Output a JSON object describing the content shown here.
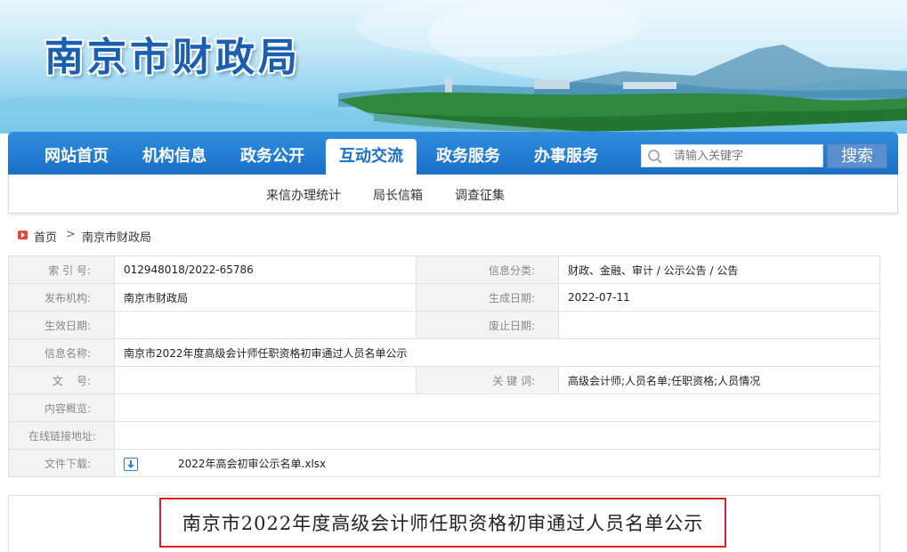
{
  "header": {
    "site_title": "南京市财政局"
  },
  "nav": {
    "items": [
      {
        "label": "网站首页",
        "active": false
      },
      {
        "label": "机构信息",
        "active": false
      },
      {
        "label": "政务公开",
        "active": false
      },
      {
        "label": "互动交流",
        "active": true
      },
      {
        "label": "政务服务",
        "active": false
      },
      {
        "label": "办事服务",
        "active": false
      }
    ],
    "search_placeholder": "请输入关键字",
    "search_button": "搜索"
  },
  "subnav": {
    "items": [
      "来信办理统计",
      "局长信箱",
      "调查征集"
    ]
  },
  "breadcrumb": {
    "home": "首页",
    "separator": ">",
    "current": "南京市财政局"
  },
  "info": {
    "index_label": "索 引 号:",
    "index_value": "012948018/2022-65786",
    "category_label": "信息分类:",
    "category_value": "财政、金融、审计 / 公示公告 / 公告",
    "publisher_label": "发布机构:",
    "publisher_value": "南京市财政局",
    "created_label": "生成日期:",
    "created_value": "2022-07-11",
    "effective_label": "生效日期:",
    "effective_value": "",
    "abolish_label": "废止日期:",
    "abolish_value": "",
    "name_label": "信息名称:",
    "name_value": "南京市2022年度高级会计师任职资格初审通过人员名单公示",
    "doc_label": "文    号:",
    "doc_value": "",
    "keywords_label": "关 键 词:",
    "keywords_value": "高级会计师;人员名单;任职资格;人员情况",
    "overview_label": "内容概览:",
    "overview_value": "",
    "link_label": "在线链接地址:",
    "link_value": "",
    "download_label": "文件下载:",
    "download_value": "2022年高会初审公示名单.xlsx"
  },
  "article": {
    "title": "南京市2022年度高级会计师任职资格初审通过人员名单公示"
  }
}
